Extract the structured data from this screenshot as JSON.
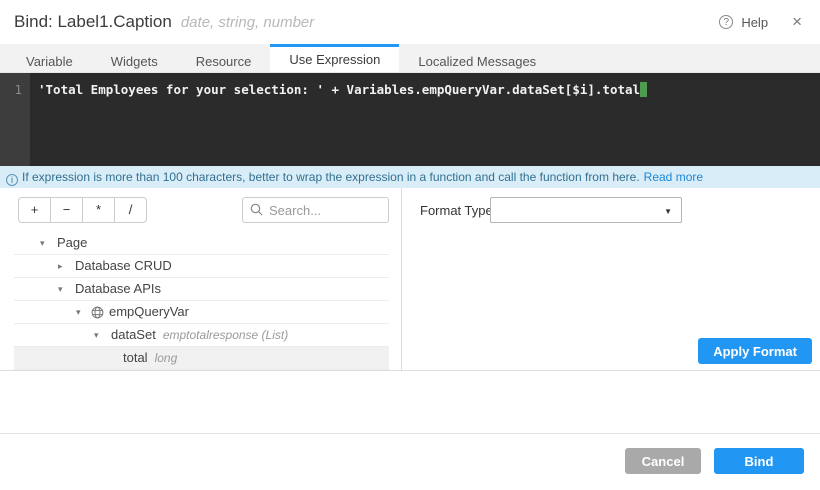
{
  "accent_color": "#2196f3",
  "header": {
    "title": "Bind: Label1.Caption",
    "subtitle": "date, string, number",
    "help_icon": "?",
    "help_label": "Help",
    "close_icon": "×"
  },
  "tabs": [
    {
      "label": "Variable"
    },
    {
      "label": "Widgets"
    },
    {
      "label": "Resource"
    },
    {
      "label": "Use Expression",
      "active": true
    },
    {
      "label": "Localized Messages"
    }
  ],
  "editor": {
    "line_number": "1",
    "code": "'Total Employees for your selection: ' + Variables.empQueryVar.dataSet[$i].total"
  },
  "info_bar": {
    "icon": "i",
    "text": "If expression is more than 100 characters, better to wrap the expression in a function and call the function from here.",
    "link": "Read more"
  },
  "left_panel": {
    "operators": {
      "plus": "+",
      "minus": "−",
      "multiply": "*",
      "divide": "/"
    },
    "search_placeholder": "Search...",
    "tree": [
      {
        "arrow": "▾",
        "label": "Page",
        "hint": ""
      },
      {
        "arrow": "▸",
        "label": "Database CRUD",
        "hint": ""
      },
      {
        "arrow": "▾",
        "label": "Database APIs",
        "hint": ""
      },
      {
        "arrow": "▾",
        "label": "empQueryVar",
        "hint": "",
        "icon": "service-variable"
      },
      {
        "arrow": "▾",
        "label": "dataSet",
        "hint": "emptotalresponse (List)"
      },
      {
        "arrow": "",
        "label": "total",
        "hint": "long",
        "selected": true
      }
    ]
  },
  "right_panel": {
    "format_type_label": "Format Type",
    "format_type_value": "",
    "dropdown_caret": "▼",
    "apply_button": "Apply Format"
  },
  "footer": {
    "cancel_button": "Cancel",
    "bind_button": "Bind"
  }
}
